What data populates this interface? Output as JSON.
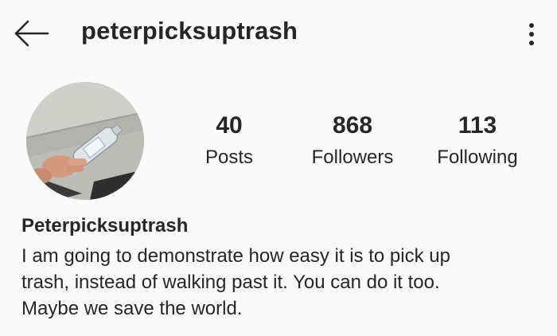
{
  "header": {
    "username": "peterpicksuptrash",
    "back_icon": "arrow-left-icon",
    "more_icon": "more-vertical-icon"
  },
  "profile": {
    "avatar_description_icon": "profile-avatar",
    "stats": [
      {
        "value": "40",
        "label": "Posts"
      },
      {
        "value": "868",
        "label": "Followers"
      },
      {
        "value": "113",
        "label": "Following"
      }
    ],
    "display_name": "Peterpicksuptrash",
    "bio_lines": [
      "I am going to demonstrate how easy it is to pick up",
      "trash, instead of walking past it.  You can do it too.",
      "Maybe we save the world."
    ]
  },
  "colors": {
    "background": "#fafafa",
    "text": "#262626"
  }
}
